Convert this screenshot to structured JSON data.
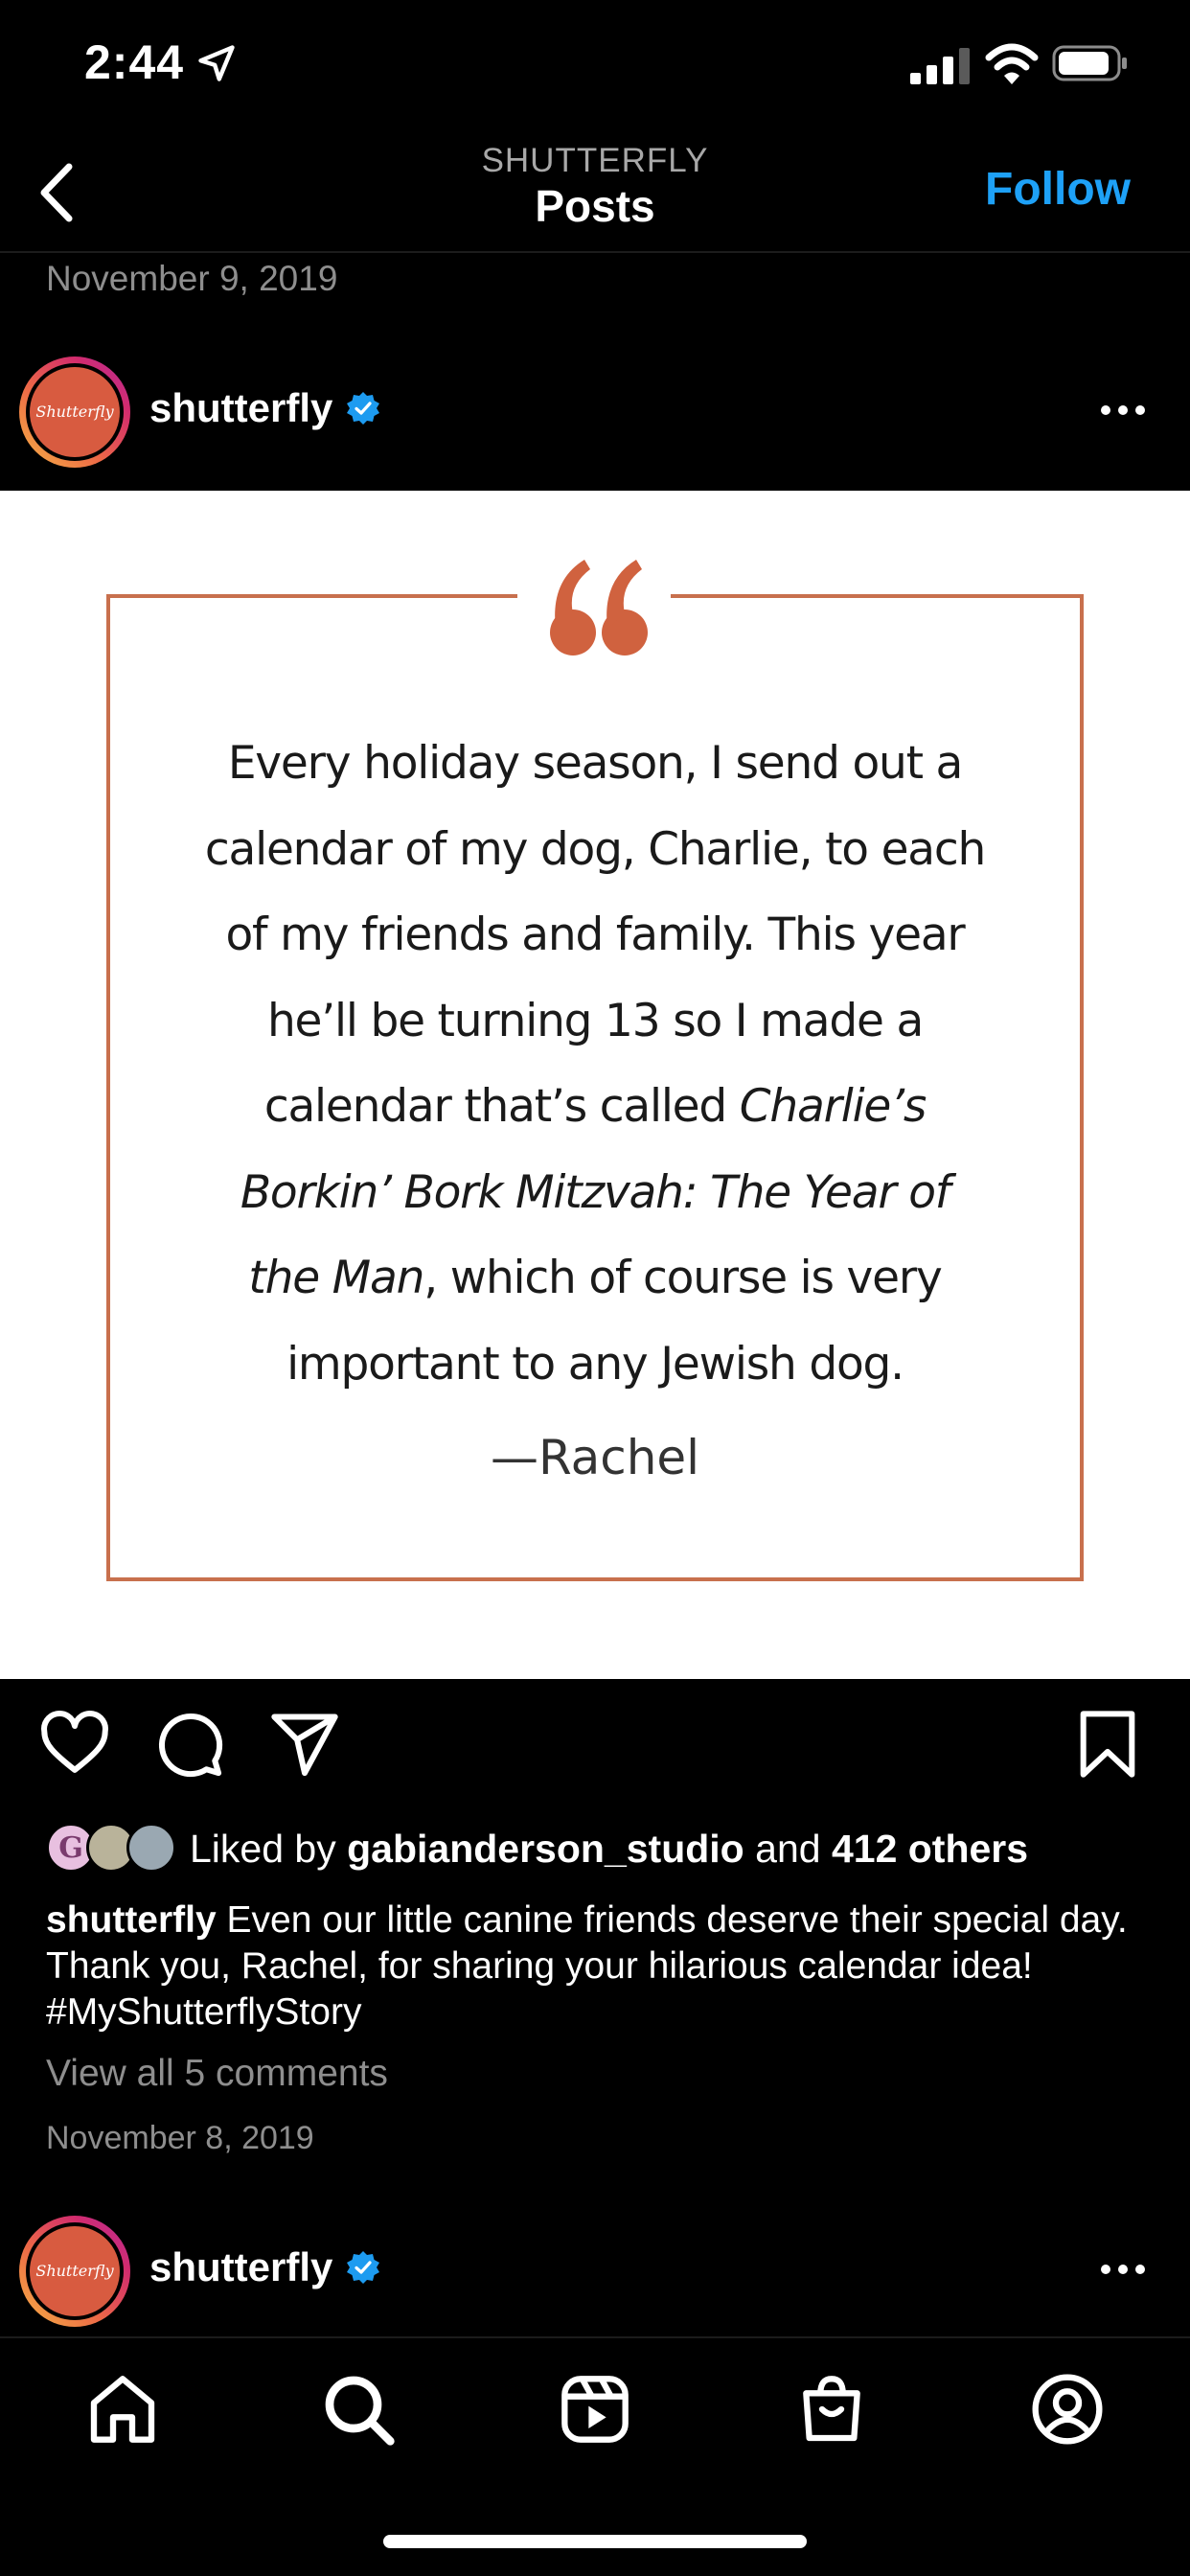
{
  "status_bar": {
    "time": "2:44"
  },
  "header": {
    "account": "SHUTTERFLY",
    "title": "Posts",
    "follow_label": "Follow"
  },
  "previous_post": {
    "date": "November 9, 2019"
  },
  "post": {
    "username": "shutterfly",
    "avatar_text": "Shutterfly",
    "image": {
      "quote_lines": [
        "Every holiday season, I send out a",
        "calendar of my dog, Charlie, to each",
        "of my friends and family.  This year",
        "he’ll be turning 13 so I made a"
      ],
      "quote_line5_prefix": "calendar that’s called ",
      "quote_line5_italic": "Charlie’s",
      "quote_line6_italic": "Borkin’ Bork Mitzvah: The Year of",
      "quote_line7_italic": "the Man",
      "quote_line7_rest": ", which of course is very",
      "quote_line8": "important to any Jewish dog.",
      "author": "—Rachel"
    },
    "likes": {
      "prefix": "Liked by",
      "user": "gabianderson_studio",
      "conjunction": "and",
      "others": "412 others"
    },
    "caption": {
      "username": "shutterfly",
      "text": "Even our little canine friends deserve their special day. Thank you, Rachel, for sharing your hilarious calendar idea! #MyShutterflyStory"
    },
    "view_comments": "View all 5 comments",
    "date": "November 8, 2019"
  },
  "next_post": {
    "username": "shutterfly",
    "avatar_text": "Shutterfly"
  },
  "icons": {
    "status": [
      "location-arrow-icon",
      "cellular-signal-icon",
      "wifi-icon",
      "battery-icon"
    ],
    "actions": [
      "heart-icon",
      "comment-icon",
      "share-icon",
      "bookmark-icon"
    ],
    "tabs": [
      "home-icon",
      "search-icon",
      "reels-icon",
      "shop-icon",
      "profile-icon"
    ]
  },
  "colors": {
    "accent": "#1ea1f7",
    "verified": "#1d9bf0",
    "quote_frame": "#c8704d",
    "avatar_bg": "#d85b40"
  }
}
